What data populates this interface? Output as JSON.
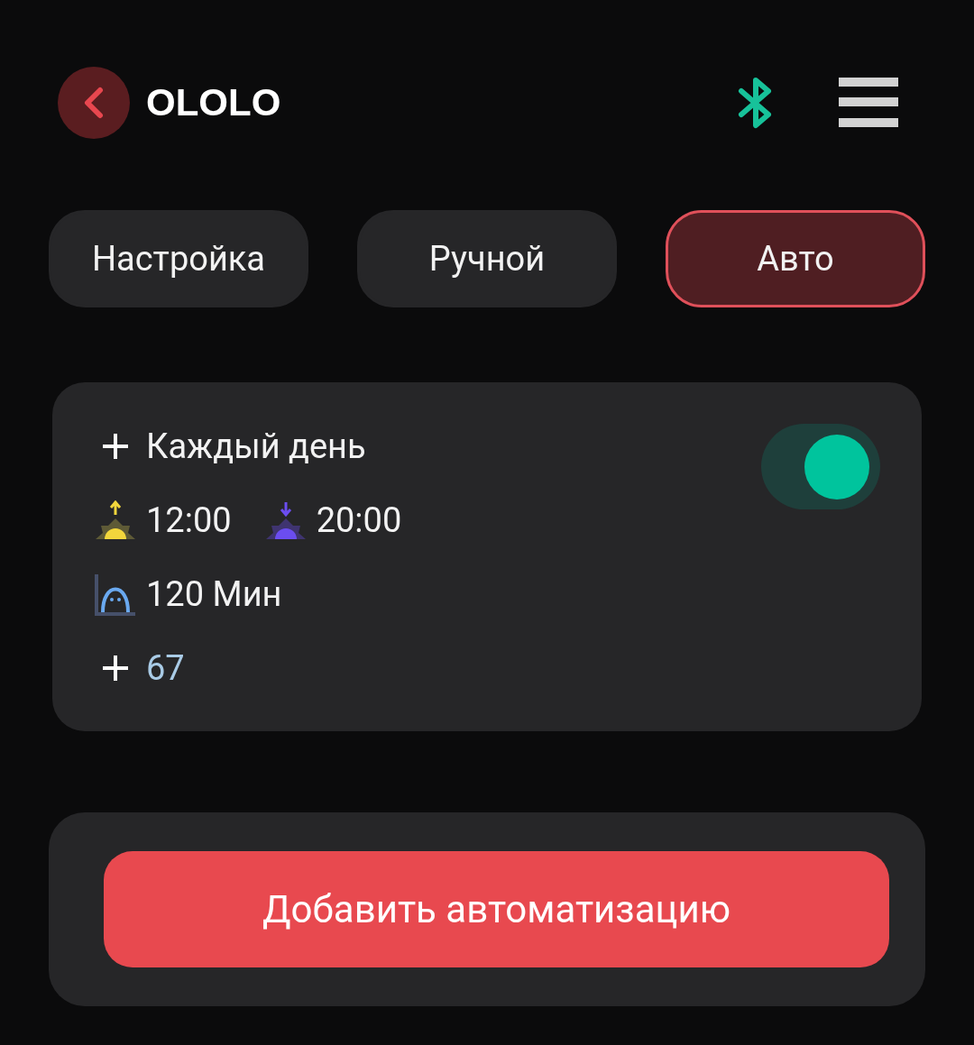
{
  "header": {
    "title": "OLOLO"
  },
  "tabs": [
    {
      "label": "Настройка",
      "selected": false
    },
    {
      "label": "Ручной",
      "selected": false
    },
    {
      "label": "Авто",
      "selected": true
    }
  ],
  "automation": {
    "schedule": "Каждый день",
    "sunrise": "12:00",
    "sunset": "20:00",
    "duration": "120 Мин",
    "value": "67",
    "enabled": true
  },
  "add_button": "Добавить автоматизацию"
}
